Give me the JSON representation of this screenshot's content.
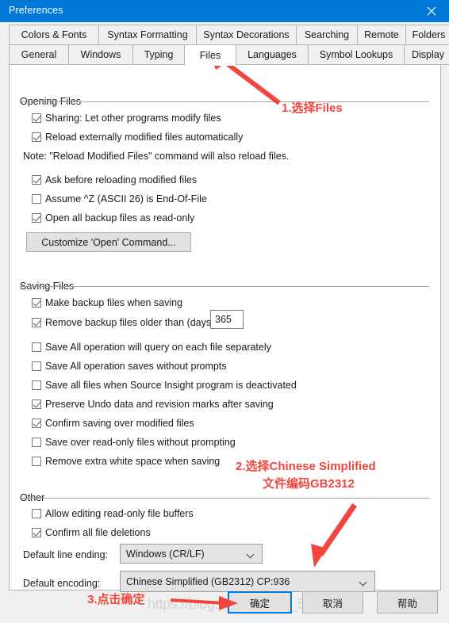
{
  "window": {
    "title": "Preferences",
    "titlebar_color": "#0078d7",
    "close_icon": "close-icon"
  },
  "tabs": {
    "row1": [
      {
        "label": "Colors & Fonts",
        "active": false
      },
      {
        "label": "Syntax Formatting",
        "active": false
      },
      {
        "label": "Syntax Decorations",
        "active": false
      },
      {
        "label": "Searching",
        "active": false
      },
      {
        "label": "Remote",
        "active": false
      },
      {
        "label": "Folders",
        "active": false
      }
    ],
    "row2": [
      {
        "label": "General",
        "active": false
      },
      {
        "label": "Windows",
        "active": false
      },
      {
        "label": "Typing",
        "active": false
      },
      {
        "label": "Files",
        "active": true
      },
      {
        "label": "Languages",
        "active": false
      },
      {
        "label": "Symbol Lookups",
        "active": false
      },
      {
        "label": "Display",
        "active": false
      }
    ]
  },
  "opening_files": {
    "group_label": "Opening Files",
    "checkboxes": [
      {
        "label": "Sharing: Let other programs modify files",
        "checked": true
      },
      {
        "label": "Reload externally modified files automatically",
        "checked": true
      }
    ],
    "note": "Note: \"Reload Modified Files\" command will also reload files.",
    "checkboxes2": [
      {
        "label": "Ask before reloading modified files",
        "checked": true
      },
      {
        "label": "Assume ^Z (ASCII 26) is End-Of-File",
        "checked": false
      },
      {
        "label": "Open all backup files as read-only",
        "checked": true
      }
    ],
    "customize_button": "Customize 'Open' Command..."
  },
  "saving_files": {
    "group_label": "Saving Files",
    "checkboxes": [
      {
        "label": "Make backup files when saving",
        "checked": true
      },
      {
        "label": "Remove backup files older than (days):",
        "checked": true
      }
    ],
    "days_value": "365",
    "checkboxes2": [
      {
        "label": "Save All operation will query on each file separately",
        "checked": false
      },
      {
        "label": "Save All operation saves without prompts",
        "checked": false
      },
      {
        "label": "Save all files when Source Insight program is deactivated",
        "checked": false
      },
      {
        "label": "Preserve Undo data and revision marks after saving",
        "checked": true
      },
      {
        "label": "Confirm saving over modified files",
        "checked": true
      },
      {
        "label": "Save over read-only files without prompting",
        "checked": false
      },
      {
        "label": "Remove extra white space when saving",
        "checked": false
      }
    ]
  },
  "other": {
    "group_label": "Other",
    "checkboxes": [
      {
        "label": "Allow editing read-only file buffers",
        "checked": false
      },
      {
        "label": "Confirm all file deletions",
        "checked": true
      }
    ],
    "line_ending_label": "Default line ending:",
    "line_ending_value": "Windows (CR/LF)",
    "encoding_label": "Default encoding:",
    "encoding_value": "Chinese Simplified (GB2312)  CP:936"
  },
  "footer": {
    "ok_label": "确定",
    "cancel_label": "取消",
    "help_label": "帮助",
    "watermark": "https://blog.csdn.net/qq_51183263"
  },
  "annotations": {
    "color": "#f2453d",
    "step1": "1.选择Files",
    "step2_line1": "2.选择Chinese Simplified",
    "step2_line2": "文件编码GB2312",
    "step3": "3.点击确定"
  }
}
